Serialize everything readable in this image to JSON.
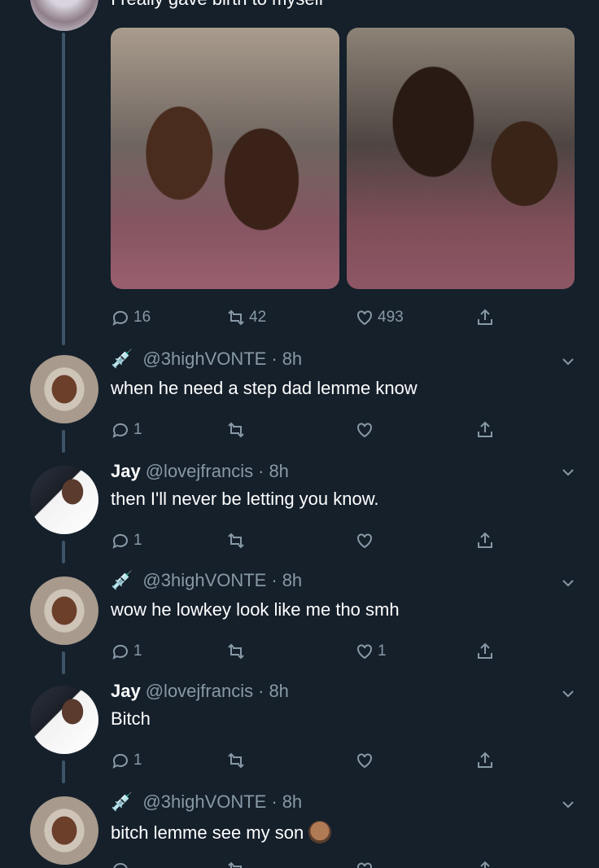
{
  "top_tweet": {
    "text": "I really gave birth to myself",
    "stats": {
      "replies": "16",
      "retweets": "42",
      "likes": "493"
    }
  },
  "replies": [
    {
      "name": "",
      "handle": "@3highVONTE",
      "time": "8h",
      "text": "when he need a step dad lemme know",
      "replies": "1",
      "retweets": "",
      "likes": ""
    },
    {
      "name": "Jay",
      "handle": "@lovejfrancis",
      "time": "8h",
      "text": "then I'll never be letting you know.",
      "replies": "1",
      "retweets": "",
      "likes": ""
    },
    {
      "name": "",
      "handle": "@3highVONTE",
      "time": "8h",
      "text": "wow he lowkey look like me tho smh",
      "replies": "1",
      "retweets": "",
      "likes": "1"
    },
    {
      "name": "Jay",
      "handle": "@lovejfrancis",
      "time": "8h",
      "text": "Bitch",
      "replies": "1",
      "retweets": "",
      "likes": ""
    },
    {
      "name": "",
      "handle": "@3highVONTE",
      "time": "8h",
      "text": "bitch lemme see my son",
      "replies": "",
      "retweets": "",
      "likes": ""
    }
  ],
  "separator": "·",
  "colors": {
    "background": "#15202b",
    "muted": "#8899a6",
    "thread": "#3d5466"
  },
  "icons": [
    "reply-icon",
    "retweet-icon",
    "like-icon",
    "share-icon",
    "caret-down-icon",
    "syringe-icon"
  ]
}
